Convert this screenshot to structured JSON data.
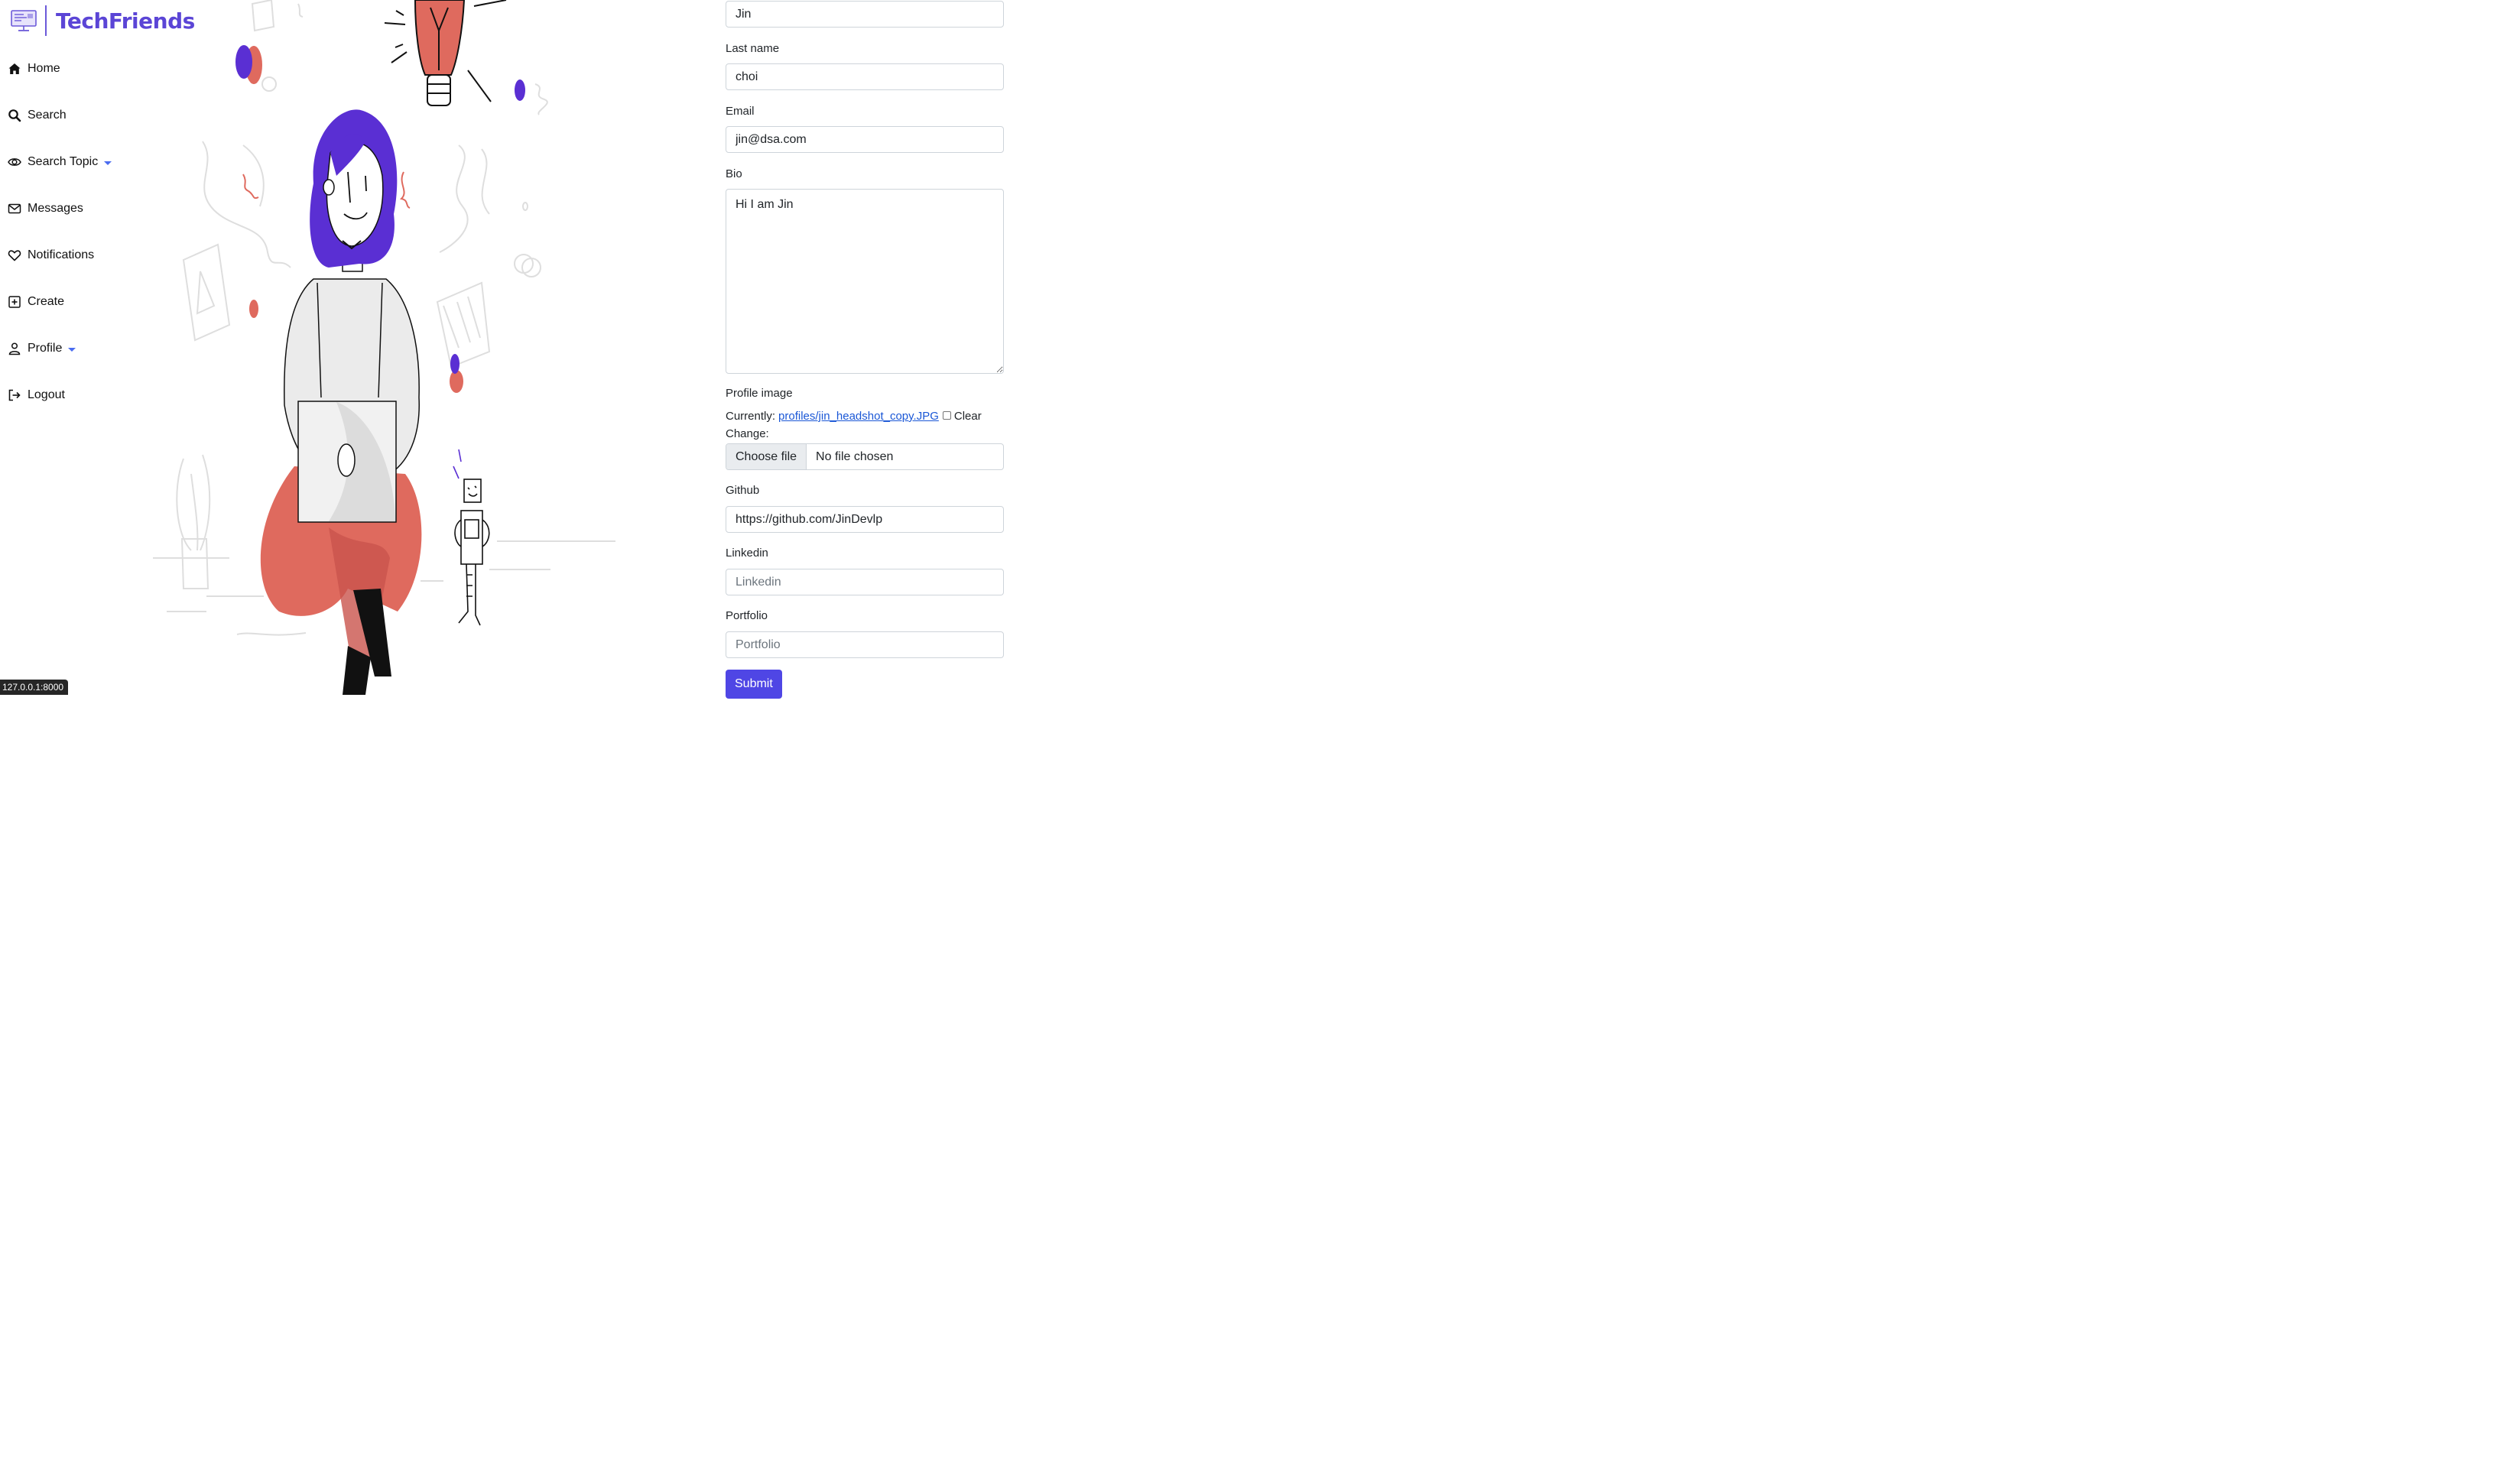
{
  "app": {
    "name": "TechFriends",
    "logo_icon": "computer-monitor-icon",
    "brand_color": "#5b45d6"
  },
  "sidebar": {
    "items": [
      {
        "label": "Home",
        "icon": "home-icon"
      },
      {
        "label": "Search",
        "icon": "search-icon"
      },
      {
        "label": "Search Topic",
        "icon": "eye-icon",
        "dropdown": true
      },
      {
        "label": "Messages",
        "icon": "envelope-icon"
      },
      {
        "label": "Notifications",
        "icon": "heart-icon"
      },
      {
        "label": "Create",
        "icon": "plus-square-icon"
      },
      {
        "label": "Profile",
        "icon": "person-icon",
        "dropdown": true
      },
      {
        "label": "Logout",
        "icon": "logout-icon"
      }
    ]
  },
  "form": {
    "first_name": {
      "value": "Jin"
    },
    "last_name": {
      "label": "Last name",
      "value": "choi"
    },
    "email": {
      "label": "Email",
      "value": "jin@dsa.com"
    },
    "bio": {
      "label": "Bio",
      "value": "Hi I am Jin"
    },
    "profile_image": {
      "label": "Profile image",
      "currently_label": "Currently:",
      "current_file": "profiles/jin_headshot_copy.JPG",
      "clear_label": "Clear",
      "change_label": "Change:",
      "choose_button": "Choose file",
      "no_file": "No file chosen"
    },
    "github": {
      "label": "Github",
      "value": "https://github.com/JinDevlp"
    },
    "linkedin": {
      "label": "Linkedin",
      "value": "",
      "placeholder": "Linkedin"
    },
    "portfolio": {
      "label": "Portfolio",
      "value": "",
      "placeholder": "Portfolio"
    },
    "submit_label": "Submit"
  },
  "status_bar": {
    "url": "127.0.0.1:8000"
  },
  "colors": {
    "accent": "#4f46e5",
    "illustration_purple": "#5a2fd3",
    "illustration_red": "#df6a5e",
    "link": "#1a57d6"
  }
}
